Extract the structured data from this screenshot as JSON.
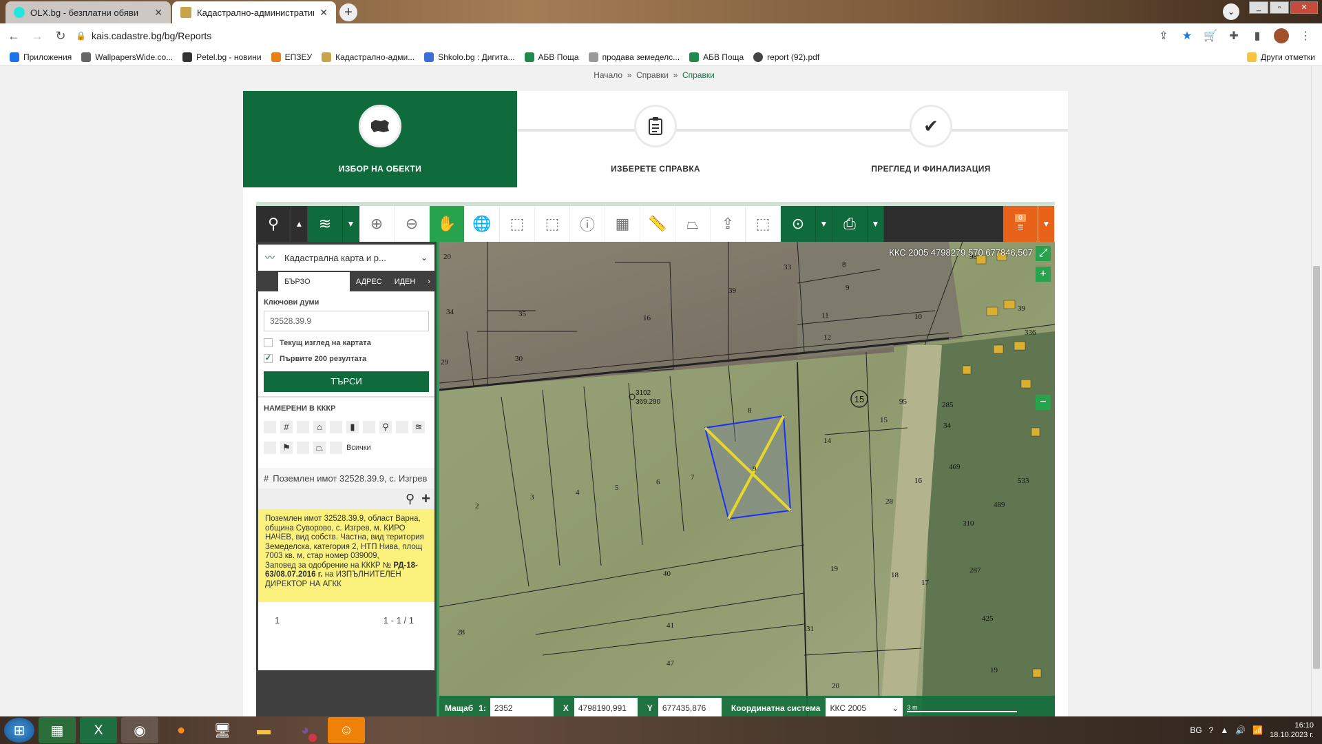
{
  "browser": {
    "tabs": [
      {
        "title": "OLX.bg - безплатни обяви",
        "active": false
      },
      {
        "title": "Кадастрално-административна",
        "active": true
      }
    ],
    "url": "kais.cadastre.bg/bg/Reports",
    "bookmarks": [
      "Приложения",
      "WallpapersWide.co...",
      "Petel.bg - новини",
      "ЕПЗЕУ",
      "Кадастрално-адми...",
      "Shkolo.bg : Дигита...",
      "АБВ Поща",
      "продава земеделс...",
      "АБВ Поща",
      "report (92).pdf"
    ],
    "bookmarks_other": "Други отметки"
  },
  "breadcrumb": {
    "home": "Начало",
    "sep": "»",
    "reports1": "Справки",
    "reports2": "Справки"
  },
  "steps": [
    {
      "label": "ИЗБОР НА ОБЕКТИ",
      "icon": "bulgaria-map-icon",
      "active": true
    },
    {
      "label": "ИЗБЕРЕТЕ СПРАВКА",
      "icon": "clipboard-icon",
      "active": false
    },
    {
      "label": "ПРЕГЛЕД И ФИНАЛИЗАЦИЯ",
      "icon": "checkmark-icon",
      "active": false
    }
  ],
  "toolbar": {
    "counter": "0"
  },
  "sidebar": {
    "layer": "Кадастрална карта и р...",
    "tabs": [
      "БЪРЗО ТЪРСЕНЕ",
      "АДРЕС",
      "ИДЕН"
    ],
    "keywords_label": "Ключови думи",
    "keywords_value": "32528.39.9",
    "chk_current_view": "Текущ изглед на картата",
    "chk_first_200": "Първите 200 резултата",
    "search_btn": "ТЪРСИ",
    "found_label": "НАМЕРЕНИ В КККР",
    "all_label": "Всички",
    "result_title": "Поземлен имот 32528.39.9, с. Изгрев",
    "result_text": "Поземлен имот 32528.39.9, област Варна, община Суворово, с. Изгрев, м. КИРО НАЧЕВ, вид собств. Частна, вид територия Земеделска, категория 2, НТП Нива, площ 7003 кв. м, стар номер 039009,",
    "result_order_prefix": "Заповед за одобрение на КККР №",
    "result_order_bold": "РД-18-63/08.07.2016 г.",
    "result_order_suffix": "на ИЗПЪЛНИТЕЛЕН ДИРЕКТОР НА АГКК",
    "pager_page": "1",
    "pager_range": "1 - 1 / 1"
  },
  "map": {
    "coord_top": "ККС 2005 4798279,570 677846,507",
    "scale_label": "Мащаб",
    "scale_prefix": "1:",
    "scale_value": "2352",
    "x_label": "X",
    "x_value": "4798190,991",
    "y_label": "Y",
    "y_value": "677435,876",
    "crs_label": "Координатна система",
    "crs_value": "ККС 2005",
    "scalebar": "3 m",
    "point_label": "3102",
    "point_elev": "369.290",
    "parcel_numbers": [
      "20",
      "34",
      "35",
      "30",
      "29",
      "16",
      "39",
      "33",
      "8",
      "9",
      "11",
      "10",
      "12",
      "15",
      "8",
      "14",
      "2",
      "3",
      "4",
      "5",
      "6",
      "7",
      "9",
      "40",
      "41",
      "47",
      "28",
      "31",
      "19",
      "18",
      "17",
      "20",
      "15",
      "16",
      "28",
      "95",
      "285",
      "34",
      "469",
      "310",
      "533",
      "489",
      "287",
      "425",
      "19",
      "98",
      "336",
      "39"
    ],
    "circled_number": "15"
  },
  "taskbar": {
    "lang": "BG",
    "time": "16:10",
    "date": "18.10.2023 г.",
    "viber_badge": "5"
  }
}
